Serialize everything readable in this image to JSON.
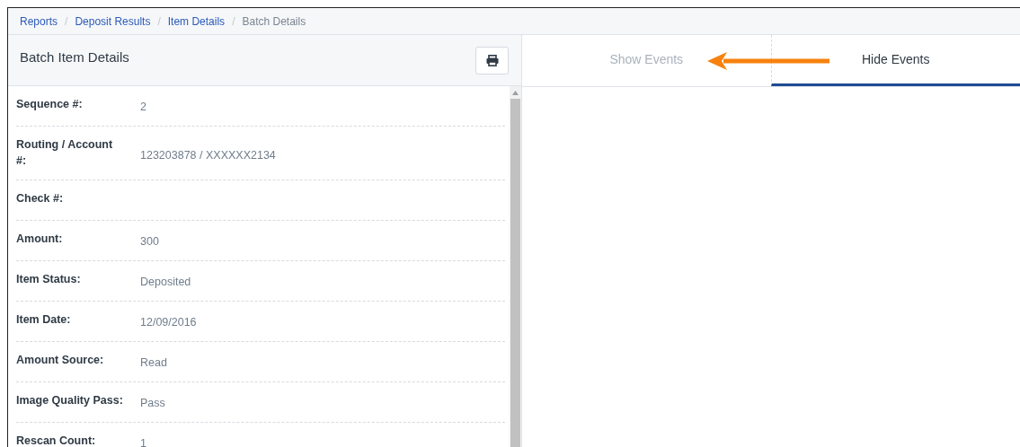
{
  "breadcrumbs": [
    {
      "label": "Reports",
      "current": false
    },
    {
      "label": "Deposit Results",
      "current": false
    },
    {
      "label": "Item Details",
      "current": false
    },
    {
      "label": "Batch Details",
      "current": true
    }
  ],
  "breadcrumb_separator": "/",
  "panel": {
    "title": "Batch Item Details"
  },
  "details": [
    {
      "label": "Sequence #:",
      "value": "2"
    },
    {
      "label": "Routing / Account #:",
      "value": "123203878 / XXXXXX2134"
    },
    {
      "label": "Check #:"
    },
    {
      "label": "Amount:",
      "value": "300"
    },
    {
      "label": "Item Status:",
      "value": "Deposited"
    },
    {
      "label": "Item Date:",
      "value": "12/09/2016"
    },
    {
      "label": "Amount Source:",
      "value": "Read"
    },
    {
      "label": "Image Quality Pass:",
      "value": "Pass"
    },
    {
      "label": "Rescan Count:",
      "value": "1"
    }
  ],
  "tabs": [
    {
      "label": "Show Events",
      "selected": false
    },
    {
      "label": "Hide Events",
      "selected": true
    }
  ]
}
